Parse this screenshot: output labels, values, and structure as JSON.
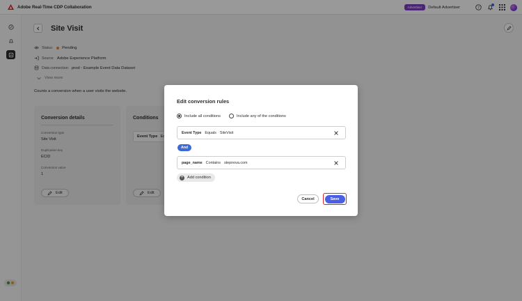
{
  "app": {
    "title": "Adobe Real-Time CDP Collaboration"
  },
  "topbar": {
    "role_badge": "Advertiser",
    "user": "Default Advertiser"
  },
  "page": {
    "title": "Site Visit",
    "status_label": "Status:",
    "status_value": "Pending",
    "source_label": "Source:",
    "source_value": "Adobe Experience Platform",
    "data_connection_label": "Data connection:",
    "data_connection_value": "prod - Example Event Data Dataset",
    "view_more": "View more",
    "description": "Counts a conversion when a user visits the website."
  },
  "conversion_details": {
    "title": "Conversion details",
    "type_label": "Conversion type",
    "type_value": "Site Visit",
    "dedup_label": "Duplication key",
    "dedup_value": "ECID",
    "value_label": "Conversion value",
    "value_value": "1",
    "edit": "Edit"
  },
  "conditions_card": {
    "title": "Conditions",
    "row_field": "Event Type",
    "row_trunc": "Eq",
    "edit": "Edit"
  },
  "modal": {
    "title": "Edit conversion rules",
    "radio_all": "Include all conditions",
    "radio_any": "Include any of the conditions",
    "conditions": [
      {
        "field": "Event Type",
        "operator": "Equals",
        "value": "SiteVisit"
      },
      {
        "field": "page_name",
        "operator": "Contains",
        "value": "stepnova.com"
      }
    ],
    "connector": "And",
    "add_condition": "Add condition",
    "cancel": "Cancel",
    "save": "Save"
  },
  "colors": {
    "accent": "#4a5ee6",
    "badge": "#7d3fc4",
    "and_pill": "#3b6ad8",
    "highlight": "#d7262b",
    "status": "#e2863b"
  }
}
